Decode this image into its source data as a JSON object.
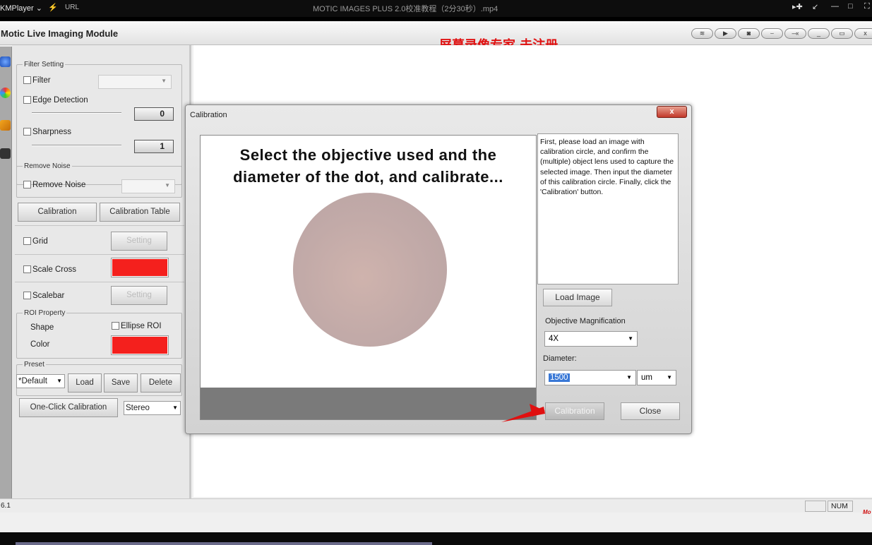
{
  "player": {
    "name": "KMPlayer",
    "dropdown": "⌄",
    "bolt": "⚡",
    "url_label": "URL",
    "file_title": "MOTIC IMAGES PLUS 2.0校准教程（2分30秒）.mp4"
  },
  "app": {
    "title": "Motic Live Imaging Module",
    "watermark": "屏幕录像专家  未注册"
  },
  "left_panel": {
    "filter_setting": {
      "legend": "Filter Setting",
      "filter_label": "Filter",
      "edge_detection_label": "Edge Detection",
      "edge_value": "0",
      "sharpness_label": "Sharpness",
      "sharpness_value": "1"
    },
    "remove_noise": {
      "legend": "Remove Noise",
      "label": "Remove Noise"
    },
    "calibration_button": "Calibration",
    "calibration_table_button": "Calibration Table",
    "grid_label": "Grid",
    "grid_setting_button": "Setting",
    "scale_cross_label": "Scale Cross",
    "scalebar_label": "Scalebar",
    "scalebar_setting_button": "Setting",
    "roi_property": {
      "legend": "ROI Property",
      "shape_label": "Shape",
      "ellipse_label": "Ellipse ROI",
      "color_label": "Color"
    },
    "preset": {
      "legend": "Preset",
      "selected": "*Default",
      "load_button": "Load",
      "save_button": "Save",
      "delete_button": "Delete"
    },
    "one_click_button": "One-Click Calibration",
    "mode_select": "Stereo"
  },
  "status_bar": {
    "version": "6.1",
    "num": "NUM",
    "brand": "Mo"
  },
  "dialog": {
    "title": "Calibration",
    "close_x": "x",
    "instruction_line1": "Select the objective used and the",
    "instruction_line2": "diameter of the dot, and calibrate...",
    "help_text": "First, please load an image with calibration circle, and confirm the (multiple) object lens used to capture the selected image.  Then input the diameter of this calibration circle. Finally, click the 'Calibration' button.",
    "load_image_button": "Load Image",
    "objective_label": "Objective Magnification",
    "objective_value": "4X",
    "diameter_label": "Diameter:",
    "diameter_value": "1500",
    "unit_value": "um",
    "calibration_button": "Calibration",
    "close_button": "Close"
  },
  "colors": {
    "scale_cross_color": "#f4201d",
    "roi_color": "#f4201d",
    "watermark_color": "#e01414",
    "selection_color": "#3978d6"
  },
  "icons": [
    "pin-icon",
    "restore-icon",
    "minimize-icon",
    "maximize-icon",
    "fullscreen-icon",
    "globe-icon",
    "color-wheel-icon",
    "tools-icon",
    "camera-icon",
    "red-arrow-icon"
  ]
}
